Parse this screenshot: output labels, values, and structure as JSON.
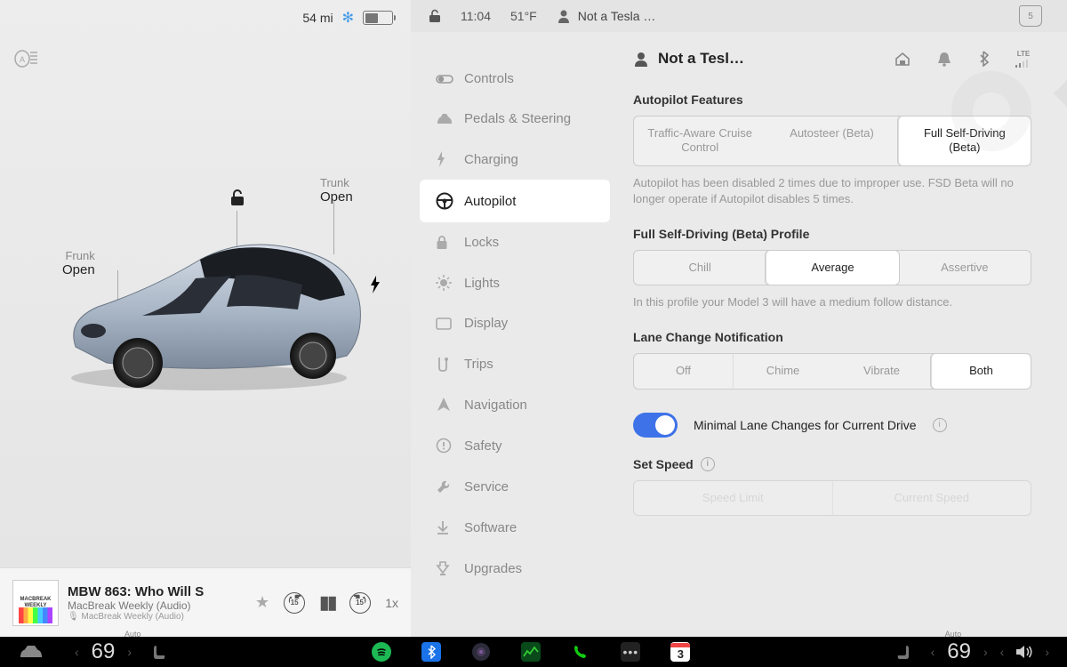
{
  "status": {
    "range": "54 mi",
    "time": "11:04",
    "temp": "51°F",
    "profile": "Not a Tesla …",
    "route_badge": "5"
  },
  "car": {
    "frunk_label": "Frunk",
    "frunk_state": "Open",
    "trunk_label": "Trunk",
    "trunk_state": "Open"
  },
  "media": {
    "title": "MBW 863: Who Will S",
    "artist": "MacBreak Weekly (Audio)",
    "source": "MacBreak Weekly (Audio)",
    "skip_back": "15",
    "skip_fwd": "15",
    "speed": "1x"
  },
  "sidebar": {
    "items": [
      {
        "icon": "⊘",
        "label": "Controls"
      },
      {
        "icon": "🚗",
        "label": "Pedals & Steering"
      },
      {
        "icon": "⚡",
        "label": "Charging"
      },
      {
        "icon": "⊙",
        "label": "Autopilot"
      },
      {
        "icon": "🔒",
        "label": "Locks"
      },
      {
        "icon": "☀",
        "label": "Lights"
      },
      {
        "icon": "▢",
        "label": "Display"
      },
      {
        "icon": "⤳",
        "label": "Trips"
      },
      {
        "icon": "➤",
        "label": "Navigation"
      },
      {
        "icon": "⚠",
        "label": "Safety"
      },
      {
        "icon": "🔧",
        "label": "Service"
      },
      {
        "icon": "⬇",
        "label": "Software"
      },
      {
        "icon": "✚",
        "label": "Upgrades"
      }
    ],
    "active_index": 3
  },
  "main": {
    "user": "Not a Tesl…",
    "lte_label": "LTE",
    "autopilot_features": {
      "title": "Autopilot Features",
      "options": [
        "Traffic-Aware Cruise Control",
        "Autosteer (Beta)",
        "Full Self-Driving (Beta)"
      ],
      "active": 2,
      "help": "Autopilot has been disabled 2 times due to improper use. FSD Beta will no longer operate if Autopilot disables 5 times."
    },
    "fsd_profile": {
      "title": "Full Self-Driving (Beta) Profile",
      "options": [
        "Chill",
        "Average",
        "Assertive"
      ],
      "active": 1,
      "help": "In this profile your Model 3 will have a medium follow distance."
    },
    "lane_change": {
      "title": "Lane Change Notification",
      "options": [
        "Off",
        "Chime",
        "Vibrate",
        "Both"
      ],
      "active": 3
    },
    "minimal_lane": {
      "label": "Minimal Lane Changes for Current Drive",
      "on": true
    },
    "set_speed": {
      "title": "Set Speed",
      "options": [
        "Speed Limit",
        "Current Speed"
      ]
    }
  },
  "bottom": {
    "temp_left": "69",
    "temp_right": "69",
    "auto_label": "Auto",
    "calendar_day": "3"
  }
}
